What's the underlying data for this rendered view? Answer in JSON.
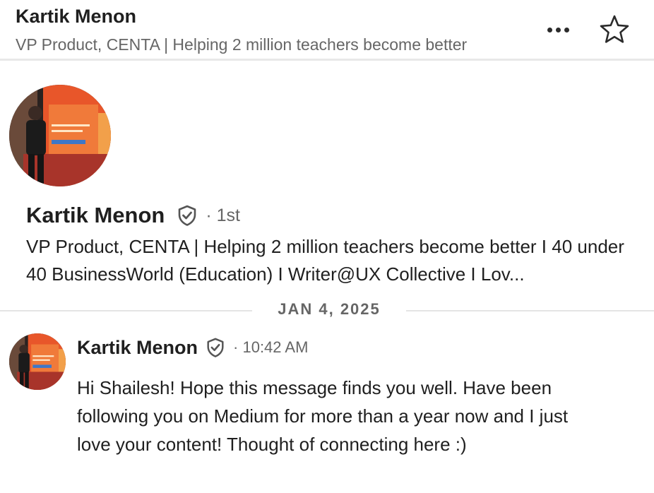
{
  "header": {
    "name": "Kartik Menon",
    "headline": "VP Product, CENTA | Helping 2 million teachers become better",
    "more_icon": "ellipsis-icon",
    "star_icon": "star-outline-icon"
  },
  "profile": {
    "name": "Kartik Menon",
    "verified_icon": "verified-shield-icon",
    "degree": "· 1st",
    "headline": "VP Product, CENTA | Helping 2 million teachers become better I 40 under 40 BusinessWorld (Education) I Writer@UX Collective I Lov..."
  },
  "divider": {
    "date": "JAN 4, 2025"
  },
  "message": {
    "sender": "Kartik Menon",
    "time": "· 10:42 AM",
    "body": "Hi Shailesh! Hope this message finds you well. Have been following you on Medium for more than a year now and I just love your content! Thought of connecting here :)"
  },
  "colors": {
    "text_primary": "#1f1f1f",
    "text_secondary": "#666666",
    "divider": "#e4e4e4",
    "photo_backdrop": "#e8562a"
  }
}
